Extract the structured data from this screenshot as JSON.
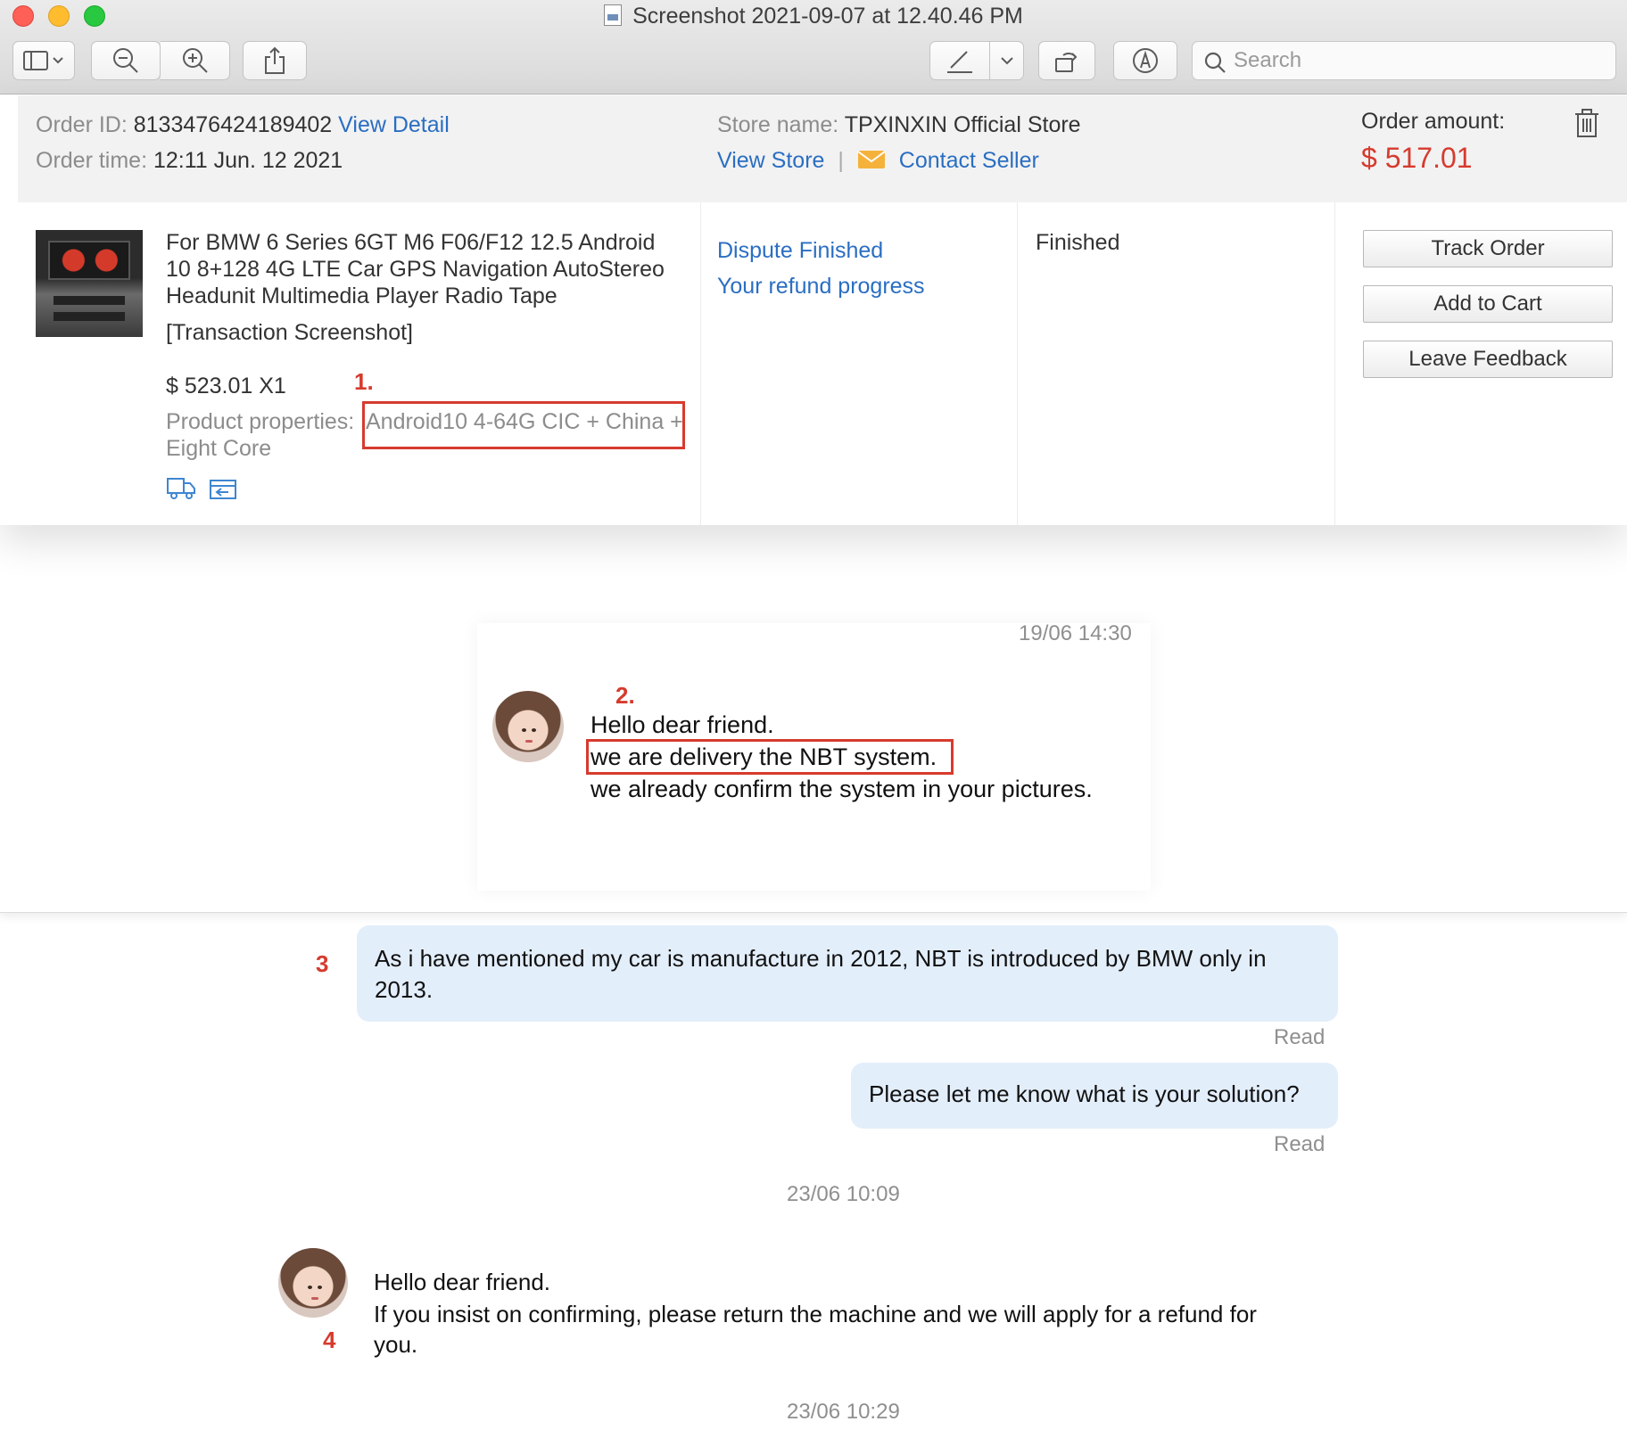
{
  "window": {
    "title": "Screenshot 2021-09-07 at 12.40.46 PM",
    "search_placeholder": "Search"
  },
  "toolbar": {
    "icons": [
      "sidebar-icon",
      "chevron-down-icon",
      "zoom-out-icon",
      "zoom-in-icon",
      "share-icon",
      "markup-pen-icon",
      "chevron-down-icon",
      "rotate-icon",
      "annotate-icon",
      "search-icon"
    ]
  },
  "order": {
    "id_label": "Order ID:",
    "id_value": "8133476424189402",
    "view_detail": "View Detail",
    "time_label": "Order time:",
    "time_value": "12:11 Jun. 12 2021",
    "store_label": "Store name:",
    "store_value": "TPXINXIN Official Store",
    "view_store": "View Store",
    "separator": "|",
    "contact_seller": "Contact Seller",
    "amount_label": "Order amount:",
    "amount_value": "$ 517.01",
    "product_title": "For BMW 6 Series 6GT M6 F06/F12 12.5 Android 10 8+128 4G LTE Car GPS Navigation AutoStereo Headunit Multimedia Player Radio Tape",
    "transaction_snapshot": "[Transaction Screenshot]",
    "price_qty": "$ 523.01 X1",
    "properties_label": "Product properties:",
    "properties_value_line1": "Android10 4-64G CIC + China +",
    "properties_value_line2": "Eight Core",
    "dispute_status": "Dispute Finished",
    "refund_progress": "Your refund progress",
    "order_status": "Finished",
    "buttons": {
      "track": "Track Order",
      "add_cart": "Add to Cart",
      "feedback": "Leave Feedback"
    },
    "annotation": "1."
  },
  "chat": {
    "messages_top": {
      "timestamp": "19/06 14:30",
      "annotation": "2.",
      "line1": "Hello dear friend.",
      "line2": "we are delivery the NBT system.",
      "line3": "we already confirm the system in your pictures."
    },
    "buyer_1": {
      "annotation": "3",
      "line1": "As i have mentioned my car is manufacture in 2012, NBT is introduced by BMW only in",
      "line2": "2013.",
      "status": "Read"
    },
    "buyer_2": {
      "text": "Please let me know what is your solution?",
      "status": "Read"
    },
    "timestamp_2": "23/06 10:09",
    "seller_2": {
      "annotation": "4",
      "line1": "Hello dear friend.",
      "line2": "If you insist on confirming, please return the machine and we will apply for a refund for",
      "line3": "you."
    },
    "timestamp_3": "23/06 10:29"
  },
  "colors": {
    "link": "#2a6ec2",
    "price": "#d63b2e",
    "annotation": "#d63b2e",
    "bubble": "#e3eefb"
  }
}
